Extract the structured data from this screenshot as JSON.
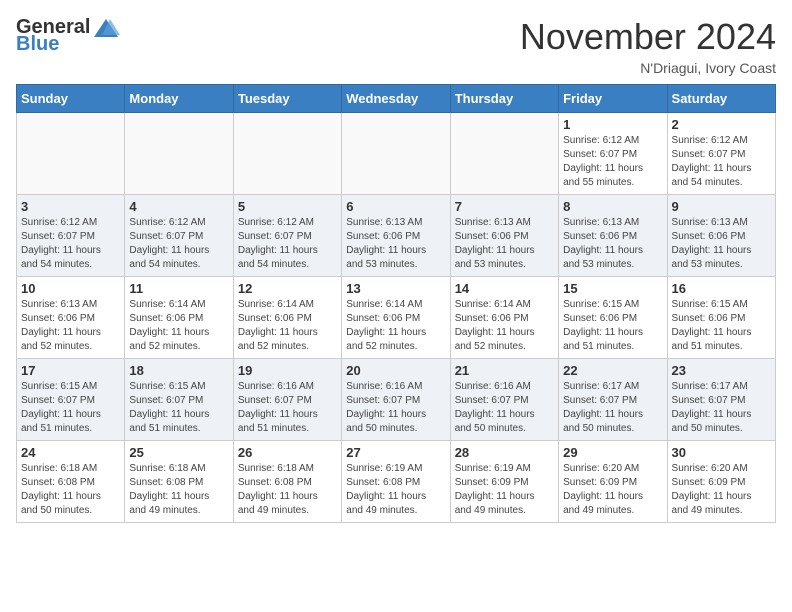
{
  "header": {
    "logo_general": "General",
    "logo_blue": "Blue",
    "title": "November 2024",
    "location": "N'Driagui, Ivory Coast"
  },
  "calendar": {
    "days_of_week": [
      "Sunday",
      "Monday",
      "Tuesday",
      "Wednesday",
      "Thursday",
      "Friday",
      "Saturday"
    ],
    "weeks": [
      [
        {
          "day": "",
          "info": ""
        },
        {
          "day": "",
          "info": ""
        },
        {
          "day": "",
          "info": ""
        },
        {
          "day": "",
          "info": ""
        },
        {
          "day": "",
          "info": ""
        },
        {
          "day": "1",
          "info": "Sunrise: 6:12 AM\nSunset: 6:07 PM\nDaylight: 11 hours\nand 55 minutes."
        },
        {
          "day": "2",
          "info": "Sunrise: 6:12 AM\nSunset: 6:07 PM\nDaylight: 11 hours\nand 54 minutes."
        }
      ],
      [
        {
          "day": "3",
          "info": "Sunrise: 6:12 AM\nSunset: 6:07 PM\nDaylight: 11 hours\nand 54 minutes."
        },
        {
          "day": "4",
          "info": "Sunrise: 6:12 AM\nSunset: 6:07 PM\nDaylight: 11 hours\nand 54 minutes."
        },
        {
          "day": "5",
          "info": "Sunrise: 6:12 AM\nSunset: 6:07 PM\nDaylight: 11 hours\nand 54 minutes."
        },
        {
          "day": "6",
          "info": "Sunrise: 6:13 AM\nSunset: 6:06 PM\nDaylight: 11 hours\nand 53 minutes."
        },
        {
          "day": "7",
          "info": "Sunrise: 6:13 AM\nSunset: 6:06 PM\nDaylight: 11 hours\nand 53 minutes."
        },
        {
          "day": "8",
          "info": "Sunrise: 6:13 AM\nSunset: 6:06 PM\nDaylight: 11 hours\nand 53 minutes."
        },
        {
          "day": "9",
          "info": "Sunrise: 6:13 AM\nSunset: 6:06 PM\nDaylight: 11 hours\nand 53 minutes."
        }
      ],
      [
        {
          "day": "10",
          "info": "Sunrise: 6:13 AM\nSunset: 6:06 PM\nDaylight: 11 hours\nand 52 minutes."
        },
        {
          "day": "11",
          "info": "Sunrise: 6:14 AM\nSunset: 6:06 PM\nDaylight: 11 hours\nand 52 minutes."
        },
        {
          "day": "12",
          "info": "Sunrise: 6:14 AM\nSunset: 6:06 PM\nDaylight: 11 hours\nand 52 minutes."
        },
        {
          "day": "13",
          "info": "Sunrise: 6:14 AM\nSunset: 6:06 PM\nDaylight: 11 hours\nand 52 minutes."
        },
        {
          "day": "14",
          "info": "Sunrise: 6:14 AM\nSunset: 6:06 PM\nDaylight: 11 hours\nand 52 minutes."
        },
        {
          "day": "15",
          "info": "Sunrise: 6:15 AM\nSunset: 6:06 PM\nDaylight: 11 hours\nand 51 minutes."
        },
        {
          "day": "16",
          "info": "Sunrise: 6:15 AM\nSunset: 6:06 PM\nDaylight: 11 hours\nand 51 minutes."
        }
      ],
      [
        {
          "day": "17",
          "info": "Sunrise: 6:15 AM\nSunset: 6:07 PM\nDaylight: 11 hours\nand 51 minutes."
        },
        {
          "day": "18",
          "info": "Sunrise: 6:15 AM\nSunset: 6:07 PM\nDaylight: 11 hours\nand 51 minutes."
        },
        {
          "day": "19",
          "info": "Sunrise: 6:16 AM\nSunset: 6:07 PM\nDaylight: 11 hours\nand 51 minutes."
        },
        {
          "day": "20",
          "info": "Sunrise: 6:16 AM\nSunset: 6:07 PM\nDaylight: 11 hours\nand 50 minutes."
        },
        {
          "day": "21",
          "info": "Sunrise: 6:16 AM\nSunset: 6:07 PM\nDaylight: 11 hours\nand 50 minutes."
        },
        {
          "day": "22",
          "info": "Sunrise: 6:17 AM\nSunset: 6:07 PM\nDaylight: 11 hours\nand 50 minutes."
        },
        {
          "day": "23",
          "info": "Sunrise: 6:17 AM\nSunset: 6:07 PM\nDaylight: 11 hours\nand 50 minutes."
        }
      ],
      [
        {
          "day": "24",
          "info": "Sunrise: 6:18 AM\nSunset: 6:08 PM\nDaylight: 11 hours\nand 50 minutes."
        },
        {
          "day": "25",
          "info": "Sunrise: 6:18 AM\nSunset: 6:08 PM\nDaylight: 11 hours\nand 49 minutes."
        },
        {
          "day": "26",
          "info": "Sunrise: 6:18 AM\nSunset: 6:08 PM\nDaylight: 11 hours\nand 49 minutes."
        },
        {
          "day": "27",
          "info": "Sunrise: 6:19 AM\nSunset: 6:08 PM\nDaylight: 11 hours\nand 49 minutes."
        },
        {
          "day": "28",
          "info": "Sunrise: 6:19 AM\nSunset: 6:09 PM\nDaylight: 11 hours\nand 49 minutes."
        },
        {
          "day": "29",
          "info": "Sunrise: 6:20 AM\nSunset: 6:09 PM\nDaylight: 11 hours\nand 49 minutes."
        },
        {
          "day": "30",
          "info": "Sunrise: 6:20 AM\nSunset: 6:09 PM\nDaylight: 11 hours\nand 49 minutes."
        }
      ]
    ]
  }
}
